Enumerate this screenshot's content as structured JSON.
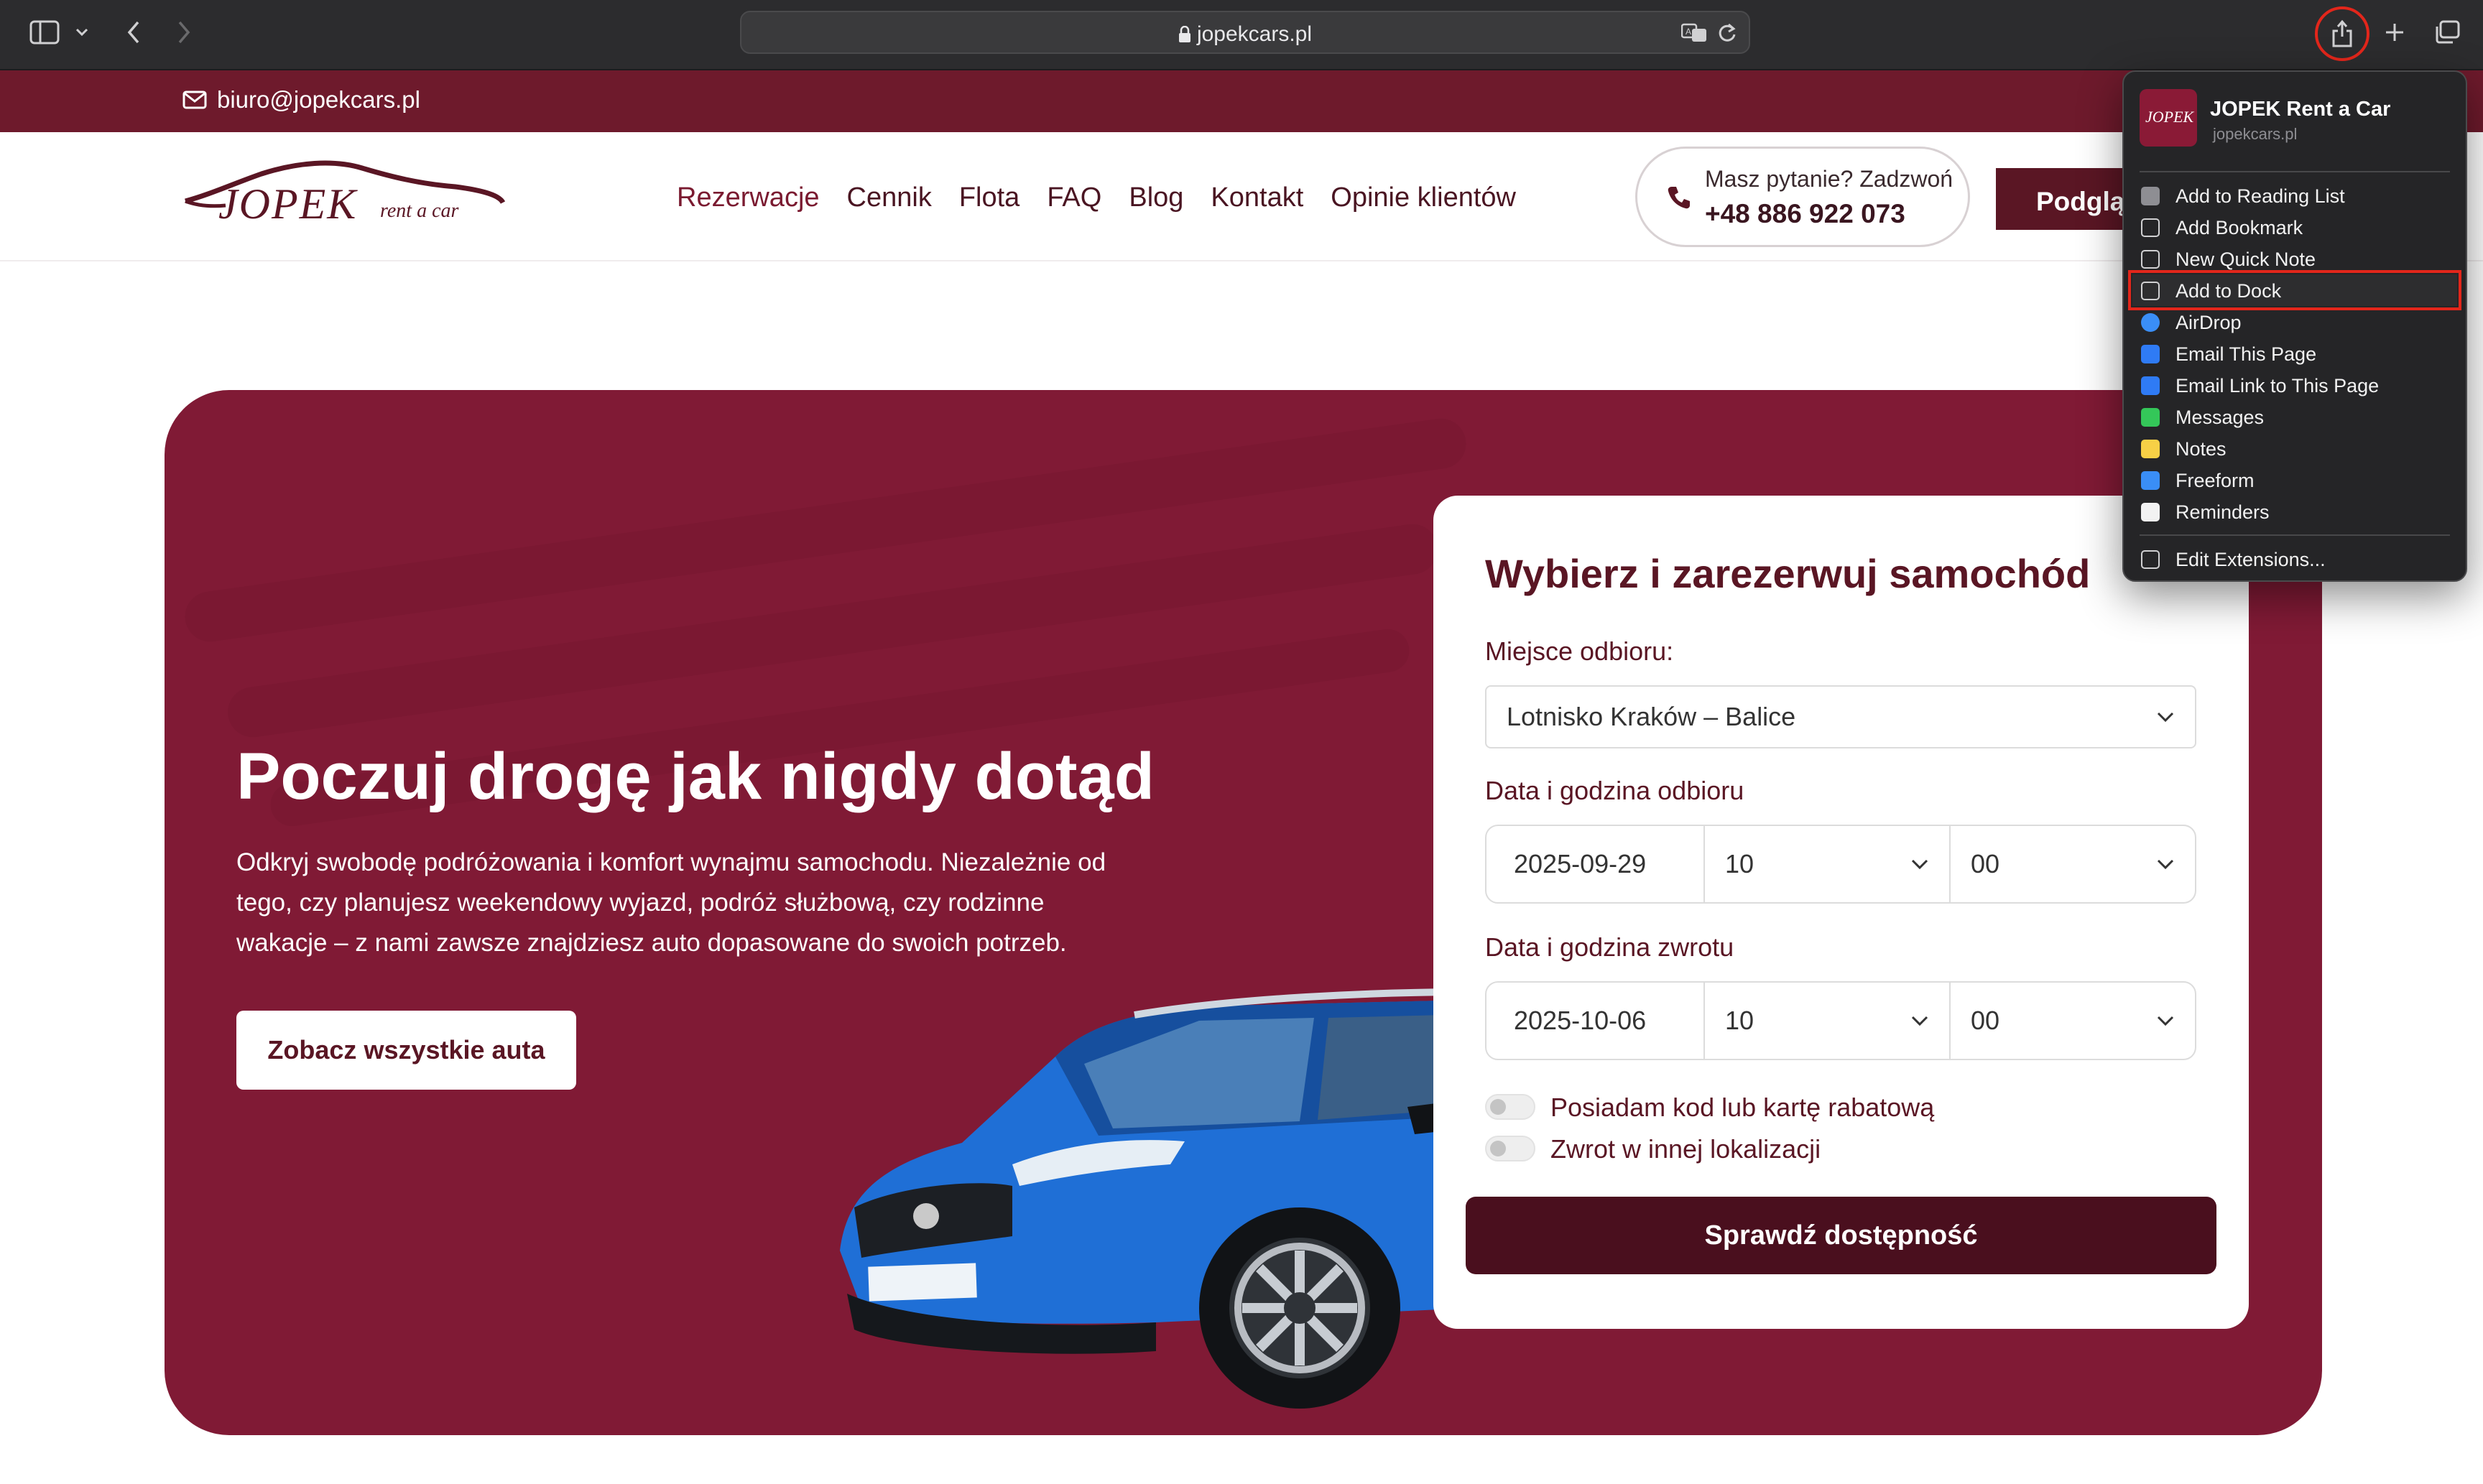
{
  "browser": {
    "url": "jopekcars.pl"
  },
  "top_strip": {
    "email": "biuro@jopekcars.pl"
  },
  "header": {
    "logo_text": "JOPEK",
    "logo_sub": "rent a car",
    "nav": [
      "Rezerwacje",
      "Cennik",
      "Flota",
      "FAQ",
      "Blog",
      "Kontakt",
      "Opinie klientów"
    ],
    "phone_question": "Masz pytanie? Zadzwoń",
    "phone_number": "+48 886 922 073",
    "preview_button": "Podgląd"
  },
  "hero": {
    "title": "Poczuj drogę jak nigdy dotąd",
    "text": "Odkryj swobodę podróżowania i komfort wynajmu samochodu. Niezależnie od tego, czy planujesz weekendowy wyjazd, podróż służbową, czy rodzinne wakacje – z nami zawsze znajdziesz auto dopasowane do swoich potrzeb.",
    "button": "Zobacz wszystkie auta"
  },
  "booking": {
    "title": "Wybierz i zarezerwuj samochód",
    "pickup_location_label": "Miejsce odbioru:",
    "pickup_location": "Lotnisko Kraków – Balice",
    "pickup_datetime_label": "Data i godzina odbioru",
    "pickup_date": "2025-09-29",
    "pickup_hour": "10",
    "pickup_minute": "00",
    "return_datetime_label": "Data i godzina zwrotu",
    "return_date": "2025-10-06",
    "return_hour": "10",
    "return_minute": "00",
    "discount_toggle_label": "Posiadam kod lub kartę rabatową",
    "other_location_toggle_label": "Zwrot w innej lokalizacji",
    "submit": "Sprawdź dostępność"
  },
  "share_menu": {
    "app_icon_text": "JOPEK",
    "app_name": "JOPEK Rent a Car",
    "app_url": "jopekcars.pl",
    "items": [
      {
        "label": "Add to Reading List",
        "icon": "reading-list-icon",
        "color": "#8e8e93"
      },
      {
        "label": "Add Bookmark",
        "icon": "bookmark-icon",
        "color": "#8e8e93"
      },
      {
        "label": "New Quick Note",
        "icon": "quick-note-icon",
        "color": "#8e8e93"
      },
      {
        "label": "Add to Dock",
        "icon": "dock-icon",
        "color": "#8e8e93"
      },
      {
        "label": "AirDrop",
        "icon": "airdrop-icon",
        "color": "#3a8ef6"
      },
      {
        "label": "Email This Page",
        "icon": "mail-icon",
        "color": "#2f7bf5"
      },
      {
        "label": "Email Link to This Page",
        "icon": "mail-icon",
        "color": "#2f7bf5"
      },
      {
        "label": "Messages",
        "icon": "messages-icon",
        "color": "#34c759"
      },
      {
        "label": "Notes",
        "icon": "notes-icon",
        "color": "#f7d046"
      },
      {
        "label": "Freeform",
        "icon": "freeform-icon",
        "color": "#3a8ef6"
      },
      {
        "label": "Reminders",
        "icon": "reminders-icon",
        "color": "#f2f2f2"
      }
    ],
    "edit_extensions": "Edit Extensions..."
  },
  "colors": {
    "brand": "#801a35",
    "brand_dark": "#5a1624",
    "strip": "#6e1a2c",
    "highlight": "#e3261b"
  }
}
